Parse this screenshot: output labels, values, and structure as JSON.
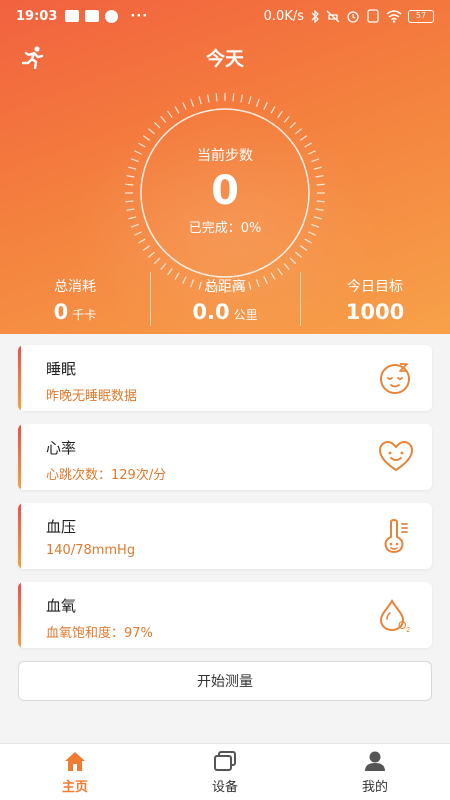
{
  "status_bar": {
    "time": "19:03",
    "dots": "···",
    "net_speed": "0.0K/s",
    "battery": "57"
  },
  "header": {
    "title": "今天"
  },
  "steps": {
    "label": "当前步数",
    "value": "0",
    "progress": "已完成：0%"
  },
  "stats": [
    {
      "label": "总消耗",
      "value": "0",
      "unit": "千卡"
    },
    {
      "label": "总距离",
      "value": "0.0",
      "unit": "公里"
    },
    {
      "label": "今日目标",
      "value": "1000",
      "unit": ""
    }
  ],
  "cards": [
    {
      "title": "睡眠",
      "subtitle": "昨晚无睡眠数据",
      "icon": "sleep-face-icon"
    },
    {
      "title": "心率",
      "subtitle": "心跳次数：129次/分",
      "icon": "heart-face-icon"
    },
    {
      "title": "血压",
      "subtitle": "140/78mmHg",
      "icon": "thermometer-face-icon"
    },
    {
      "title": "血氧",
      "subtitle": "血氧饱和度：97%",
      "icon": "oxygen-drop-icon"
    }
  ],
  "measure_button": {
    "label": "开始测量"
  },
  "tabbar": [
    {
      "label": "主页",
      "icon": "home-icon",
      "active": true
    },
    {
      "label": "设备",
      "icon": "device-icon",
      "active": false
    },
    {
      "label": "我的",
      "icon": "profile-icon",
      "active": false
    }
  ],
  "colors": {
    "accent": "#f07b33",
    "gradient_start": "#f2613f",
    "gradient_end": "#f7a14a",
    "card_bar": "#e8504b"
  }
}
